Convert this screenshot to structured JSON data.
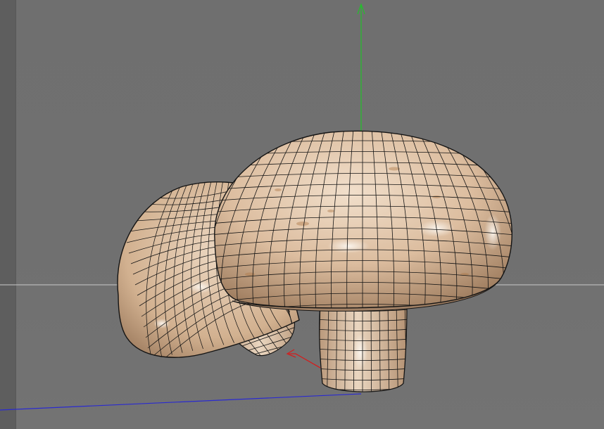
{
  "viewport": {
    "background": "#707070",
    "side_panel": "#5e5e5e",
    "horizon_line_color": "#c8c8c8"
  },
  "axes": {
    "y_axis_color": "#22c02a",
    "x_axis_color": "#d02020",
    "z_axis_color": "#2a2ad0"
  },
  "scene": {
    "objects": [
      {
        "name": "mushroom-front",
        "display": "textured-wireframe"
      },
      {
        "name": "mushroom-back-tilted",
        "display": "textured-wireframe"
      }
    ],
    "material_color": "#d9b99a",
    "highlight_color": "#f5ece2",
    "wire_color": "#141414"
  }
}
